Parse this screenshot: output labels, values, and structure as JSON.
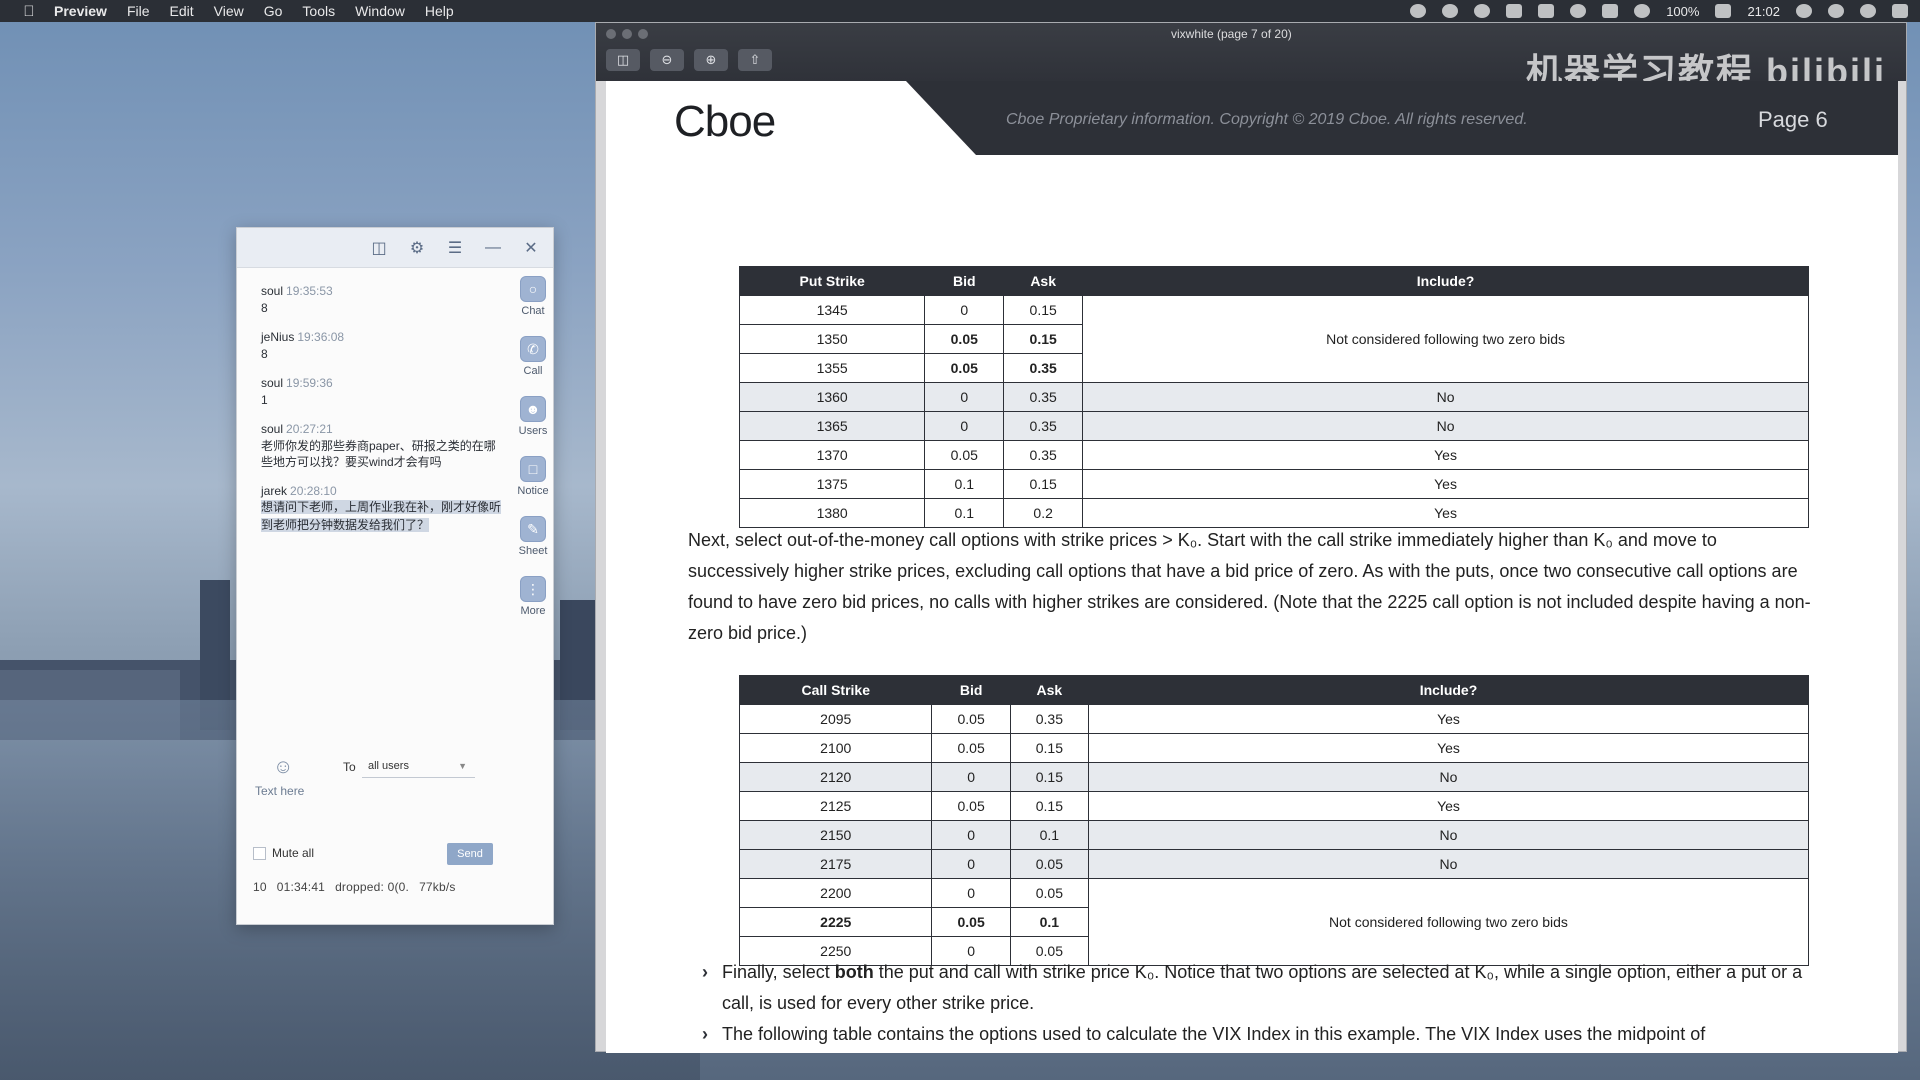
{
  "menubar": {
    "app_name": "Preview",
    "menus": [
      "File",
      "Edit",
      "View",
      "Go",
      "Tools",
      "Window",
      "Help"
    ],
    "battery": "100%",
    "time": "21:02"
  },
  "chat": {
    "messages": [
      {
        "user": "soul",
        "time": "19:35:53",
        "text": "8"
      },
      {
        "user": "jeNius",
        "time": "19:36:08",
        "text": "8"
      },
      {
        "user": "soul",
        "time": "19:59:36",
        "text": "1"
      },
      {
        "user": "soul",
        "time": "20:27:21",
        "text": "老师你发的那些券商paper、研报之类的在哪些地方可以找？要买wind才会有吗"
      },
      {
        "user": "jarek",
        "time": "20:28:10",
        "text": "想请问下老师，上周作业我在补，刚才好像听到老师把分钟数据发给我们了？"
      }
    ],
    "side_items": [
      {
        "label": "Chat",
        "icon": "chat-icon"
      },
      {
        "label": "Call",
        "icon": "call-icon"
      },
      {
        "label": "Users",
        "icon": "users-icon"
      },
      {
        "label": "Notice",
        "icon": "notice-icon"
      },
      {
        "label": "Sheet",
        "icon": "sheet-icon"
      },
      {
        "label": "More",
        "icon": "more-icon"
      }
    ],
    "to_label": "To",
    "to_value": "all users",
    "text_placeholder": "Text here",
    "mute_label": "Mute all",
    "send_label": "Send",
    "status": {
      "count": "10",
      "duration": "01:34:41",
      "dropped": "dropped: 0(0.",
      "rate": "77kb/s"
    }
  },
  "preview": {
    "doc_title": "vixwhite (page 7 of 20)",
    "watermark": "机器学习教程 bilibili",
    "logo": "Cboe",
    "copyright": "Cboe Proprietary information. Copyright © 2019 Cboe. All rights reserved.",
    "page_label": "Page 6",
    "put_table": {
      "headers": [
        "Put Strike",
        "Bid",
        "Ask",
        "Include?"
      ],
      "rows": [
        {
          "strike": "1345",
          "bid": "0",
          "ask": "0.15"
        },
        {
          "strike": "1350",
          "bid": "0.05",
          "ask": "0.15"
        },
        {
          "strike": "1355",
          "bid": "0.05",
          "ask": "0.35"
        },
        {
          "strike": "1360",
          "bid": "0",
          "ask": "0.35",
          "include": "No"
        },
        {
          "strike": "1365",
          "bid": "0",
          "ask": "0.35",
          "include": "No"
        },
        {
          "strike": "1370",
          "bid": "0.05",
          "ask": "0.35",
          "include": "Yes"
        },
        {
          "strike": "1375",
          "bid": "0.1",
          "ask": "0.15",
          "include": "Yes"
        },
        {
          "strike": "1380",
          "bid": "0.1",
          "ask": "0.2",
          "include": "Yes"
        }
      ],
      "note": "Not considered following two zero bids"
    },
    "paragraph": "Next, select out-of-the-money call options with strike prices > K₀.  Start with the call strike immediately higher than K₀ and move to successively higher strike prices, excluding call options that have a bid price of zero.  As with the puts, once two consecutive call options are found to have zero bid prices, no calls with higher strikes are considered.  (Note that the 2225 call option is not included despite having a non-zero bid price.)",
    "call_table": {
      "headers": [
        "Call Strike",
        "Bid",
        "Ask",
        "Include?"
      ],
      "rows": [
        {
          "strike": "2095",
          "bid": "0.05",
          "ask": "0.35",
          "include": "Yes"
        },
        {
          "strike": "2100",
          "bid": "0.05",
          "ask": "0.15",
          "include": "Yes"
        },
        {
          "strike": "2120",
          "bid": "0",
          "ask": "0.15",
          "include": "No"
        },
        {
          "strike": "2125",
          "bid": "0.05",
          "ask": "0.15",
          "include": "Yes"
        },
        {
          "strike": "2150",
          "bid": "0",
          "ask": "0.1",
          "include": "No"
        },
        {
          "strike": "2175",
          "bid": "0",
          "ask": "0.05",
          "include": "No"
        },
        {
          "strike": "2200",
          "bid": "0",
          "ask": "0.05"
        },
        {
          "strike": "2225",
          "bid": "0.05",
          "ask": "0.1"
        },
        {
          "strike": "2250",
          "bid": "0",
          "ask": "0.05"
        }
      ],
      "note": "Not considered following two zero bids"
    },
    "bullet1_pre": "Finally, select ",
    "bullet1_bold": "both",
    "bullet1_post": " the put and call with strike price K₀. Notice that two options are selected at K₀, while a single option, either a put or a call, is used for every other strike price.",
    "bullet2": "The following table contains the options used to calculate the VIX Index in this example.  The VIX Index uses the midpoint of"
  }
}
